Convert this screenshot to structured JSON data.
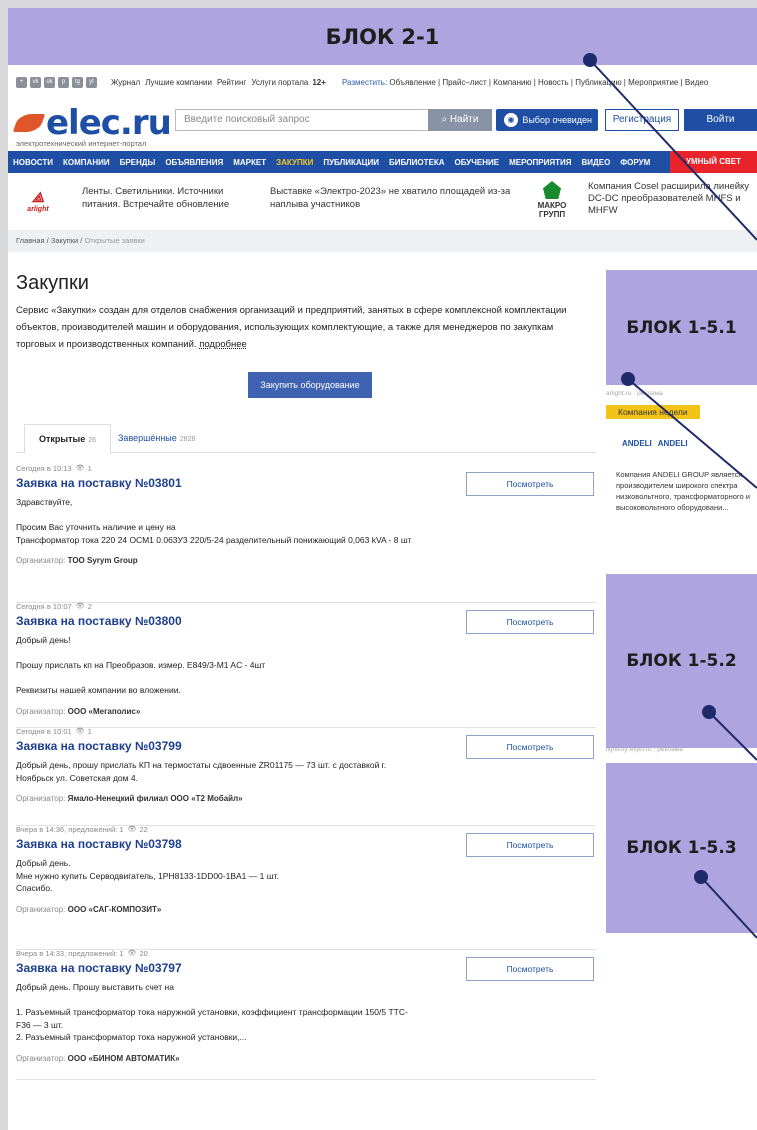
{
  "blocks": {
    "top": "БЛОК 2-1",
    "b1": "БЛОК 1-5.1",
    "b2": "БЛОК 1-5.2",
    "b3": "БЛОК 1-5.3"
  },
  "topbar": {
    "social": [
      "+",
      "vk",
      "ok",
      "p",
      "tg",
      "yt"
    ],
    "links": [
      "Журнал",
      "Лучшие компании",
      "Рейтинг",
      "Услуги портала"
    ],
    "age": "12+",
    "place_label": "Разместить:",
    "place_items": "Объявление | Прайс–лист | Компанию | Новость | Публикацию | Мероприятие | Видео"
  },
  "header": {
    "logo": "elec.ru",
    "logo_sub": "электротехнический интернет-портал",
    "search_placeholder": "Введите поисковый запрос",
    "find": "Найти",
    "eye": "Выбор очевиден",
    "register": "Регистрация",
    "login": "Войти"
  },
  "nav": [
    "НОВОСТИ",
    "КОМПАНИИ",
    "БРЕНДЫ",
    "ОБЪЯВЛЕНИЯ",
    "МАРКЕТ",
    "ЗАКУПКИ",
    "ПУБЛИКАЦИИ",
    "БИБЛИОТЕКА",
    "ОБУЧЕНИЕ",
    "МЕРОПРИЯТИЯ",
    "ВИДЕО",
    "ФОРУМ"
  ],
  "nav_active": "ЗАКУПКИ",
  "nav_smart": "УМНЫЙ СВЕТ",
  "news": {
    "logo1": "arlight",
    "n1": "Ленты. Светильники. Источники питания. Встречайте обновление",
    "n2": "Выставке «Электро-2023» не хватило площадей из-за наплыва участников",
    "logo3": "МАКРО ГРУПП",
    "n3": "Компания Cosel расширила линейку DC-DC преобразователей MHFS и MHFW"
  },
  "breadcrumbs": {
    "home": "Главная",
    "sep": "/",
    "section": "Закупки",
    "current": "Открытые заявки"
  },
  "page": {
    "title": "Закупки",
    "intro": "Сервис «Закупки» создан для отделов снабжения организаций и предприятий, занятых в сфере комплексной комплектации объектов, производителей машин и оборудования, использующих комплектующие, а также для менеджеров по закупкам торговых и производственных компаний.",
    "more": "подробнее",
    "buy": "Закупить оборудование"
  },
  "tabs": {
    "open_label": "Открытые",
    "open_count": "26",
    "done_label": "Завершённые",
    "done_count": "2828"
  },
  "view_label": "Посмотреть",
  "org_label": "Организатор:",
  "lots": [
    {
      "meta": "Сегодня в 10:13",
      "views": "1",
      "title": "Заявка на поставку №03801",
      "body": [
        "Здравствуйте,",
        "",
        "Просим Вас уточнить наличие и цену на",
        "Трансформатор тока 220 24 ОСМ1 0.063У3 220/5-24 разделительный понижающий 0,063 kVA - 8 шт"
      ],
      "org": "ТОО Syrym Group"
    },
    {
      "meta": "Сегодня в 10:07",
      "views": "2",
      "title": "Заявка на поставку №03800",
      "body": [
        "Добрый день!",
        "",
        "Прошу прислать кп на Преобразов. измер. E849/3-M1 AC - 4шт",
        "",
        "Реквизиты нашей компании во вложении."
      ],
      "org": "ООО «Мегаполис»"
    },
    {
      "meta": "Сегодня в 10:01",
      "views": "1",
      "title": "Заявка на поставку №03799",
      "body": [
        "Добрый день, прошу прислать КП на термостаты сдвоенные ZR01175 — 73 шт. с доставкой г.",
        "Ноябрьск ул. Советская дом 4."
      ],
      "org": "Ямало-Ненецкий филиал ООО «Т2 Мобайл»"
    },
    {
      "meta": "Вчера в 14:36, предложений: 1",
      "views": "22",
      "title": "Заявка на поставку №03798",
      "body": [
        "Добрый день.",
        "Мне нужно купить Серводвигатель, 1PH8133-1DD00-1BA1 — 1 шт.",
        "Спасибо."
      ],
      "org": "ООО «САГ-КОМПОЗИТ»"
    },
    {
      "meta": "Вчера в 14:33, предложений: 1",
      "views": "20",
      "title": "Заявка на поставку №03797",
      "body": [
        "Добрый день. Прошу выставить счет на",
        "",
        "1. Разъемный трансформатор тока наружной установки, коэффициент трансформации 150/5 ТТС-",
        "F36 — 3 шт.",
        "2. Разъемный трансформатор тока наружной установки,..."
      ],
      "org": "ООО «БИНОМ АВТОМАТИК»"
    }
  ],
  "side": {
    "ad1": "arlight.ru · реклама",
    "week_label": "Компания недели",
    "week_logo": "ANDELI",
    "week_logo_small": "ANDELI",
    "week_text": "Компания ANDELI GROUP является производителем широкого спектра низковольтного, трансформаторного и высоковольтного оборудовани...",
    "ad2": "lightcity-expo.ru · реклама"
  }
}
